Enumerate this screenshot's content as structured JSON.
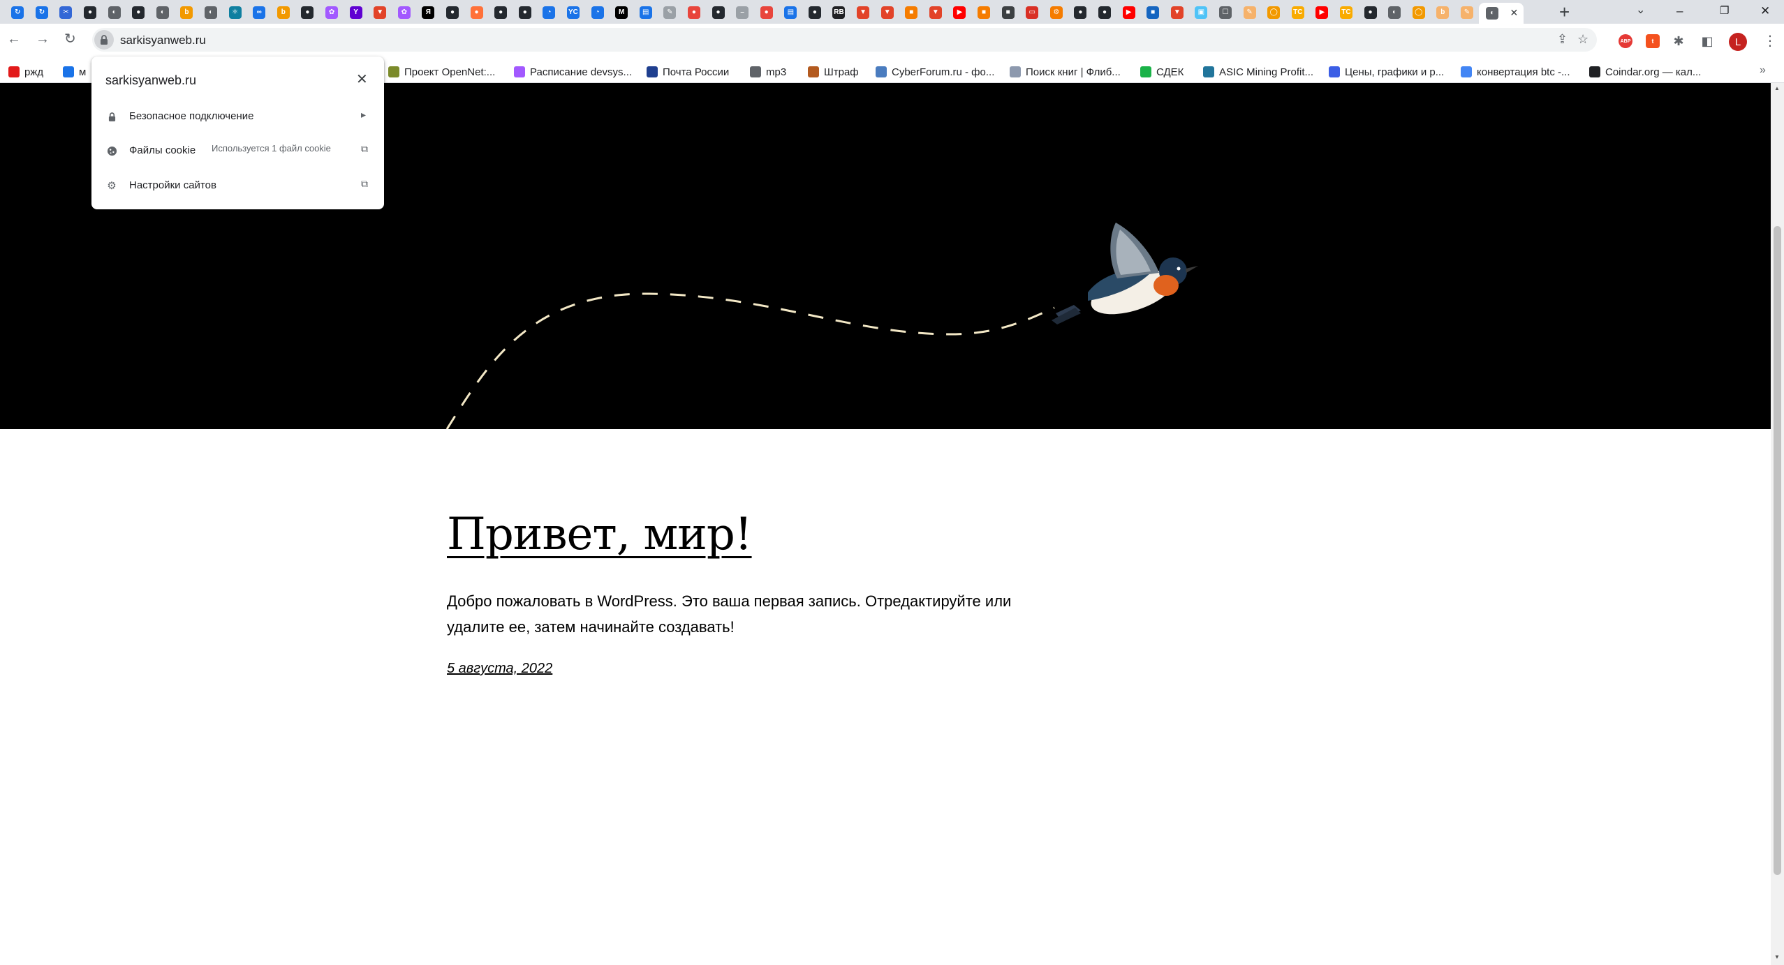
{
  "browser": {
    "tabs": [
      {
        "icon": "sync-icon",
        "color": "#1a73e8",
        "glyph": "↻"
      },
      {
        "icon": "sync-icon",
        "color": "#1a73e8",
        "glyph": "↻"
      },
      {
        "icon": "scissors-icon",
        "color": "#3367d6",
        "glyph": "✂"
      },
      {
        "icon": "github-icon",
        "color": "#24292f",
        "glyph": "●"
      },
      {
        "icon": "globe-icon",
        "color": "#5f6368",
        "glyph": "◐"
      },
      {
        "icon": "github-icon",
        "color": "#24292f",
        "glyph": "●"
      },
      {
        "icon": "globe-icon",
        "color": "#5f6368",
        "glyph": "◐"
      },
      {
        "icon": "site-icon",
        "color": "#f29900",
        "glyph": "b"
      },
      {
        "icon": "globe-icon",
        "color": "#5f6368",
        "glyph": "◐"
      },
      {
        "icon": "react-icon",
        "color": "#0e7fa0",
        "glyph": "⚛"
      },
      {
        "icon": "link-icon",
        "color": "#1a73e8",
        "glyph": "∞"
      },
      {
        "icon": "site-icon",
        "color": "#f29900",
        "glyph": "b"
      },
      {
        "icon": "github-icon",
        "color": "#24292f",
        "glyph": "●"
      },
      {
        "icon": "figma-icon",
        "color": "#a259ff",
        "glyph": "✿"
      },
      {
        "icon": "yahoo-icon",
        "color": "#6001d2",
        "glyph": "Y"
      },
      {
        "icon": "gitlab-icon",
        "color": "#e24329",
        "glyph": "▼"
      },
      {
        "icon": "figma-icon",
        "color": "#a259ff",
        "glyph": "✿"
      },
      {
        "icon": "yandex-icon",
        "color": "#000000",
        "glyph": "Я"
      },
      {
        "icon": "github-icon",
        "color": "#24292f",
        "glyph": "●"
      },
      {
        "icon": "firefox-icon",
        "color": "#ff7139",
        "glyph": "●"
      },
      {
        "icon": "github-icon",
        "color": "#24292f",
        "glyph": "●"
      },
      {
        "icon": "github-icon",
        "color": "#24292f",
        "glyph": "●"
      },
      {
        "icon": "safari-icon",
        "color": "#1a73e8",
        "glyph": "◔"
      },
      {
        "icon": "yc-icon",
        "color": "#1a73e8",
        "glyph": "YC"
      },
      {
        "icon": "safari-icon",
        "color": "#1a73e8",
        "glyph": "◔"
      },
      {
        "icon": "medium-icon",
        "color": "#000000",
        "glyph": "M"
      },
      {
        "icon": "doc-icon",
        "color": "#1a73e8",
        "glyph": "▤"
      },
      {
        "icon": "brush-icon",
        "color": "#9aa0a6",
        "glyph": "✎"
      },
      {
        "icon": "pin-icon",
        "color": "#e8453c",
        "glyph": "●"
      },
      {
        "icon": "github-icon",
        "color": "#24292f",
        "glyph": "●"
      },
      {
        "icon": "dash-icon",
        "color": "#9aa0a6",
        "glyph": "–"
      },
      {
        "icon": "pin-icon",
        "color": "#e8453c",
        "glyph": "●"
      },
      {
        "icon": "doc-icon",
        "color": "#1a73e8",
        "glyph": "▤"
      },
      {
        "icon": "github-icon",
        "color": "#24292f",
        "glyph": "●"
      },
      {
        "icon": "rb-icon",
        "color": "#202124",
        "glyph": "RB"
      },
      {
        "icon": "gitlab-icon",
        "color": "#e24329",
        "glyph": "▼"
      },
      {
        "icon": "gitlab-icon",
        "color": "#e24329",
        "glyph": "▼"
      },
      {
        "icon": "store-icon",
        "color": "#f57c00",
        "glyph": "■"
      },
      {
        "icon": "gitlab-icon",
        "color": "#e24329",
        "glyph": "▼"
      },
      {
        "icon": "youtube-icon",
        "color": "#ff0000",
        "glyph": "▶"
      },
      {
        "icon": "store-icon",
        "color": "#f57c00",
        "glyph": "■"
      },
      {
        "icon": "square-icon",
        "color": "#3c4043",
        "glyph": "■"
      },
      {
        "icon": "screen-icon",
        "color": "#d93025",
        "glyph": "▭"
      },
      {
        "icon": "gear-icon",
        "color": "#f57c00",
        "glyph": "⚙"
      },
      {
        "icon": "github-icon",
        "color": "#24292f",
        "glyph": "●"
      },
      {
        "icon": "github-icon",
        "color": "#24292f",
        "glyph": "●"
      },
      {
        "icon": "youtube-icon",
        "color": "#ff0000",
        "glyph": "▶"
      },
      {
        "icon": "app-icon",
        "color": "#1565c0",
        "glyph": "■"
      },
      {
        "icon": "gitlab-icon",
        "color": "#e24329",
        "glyph": "▼"
      },
      {
        "icon": "image-icon",
        "color": "#4fc3f7",
        "glyph": "▣"
      },
      {
        "icon": "book-icon",
        "color": "#5f6368",
        "glyph": "☐"
      },
      {
        "icon": "brush-icon",
        "color": "#f6b26b",
        "glyph": "✎"
      },
      {
        "icon": "chat-icon",
        "color": "#f29900",
        "glyph": "◯"
      },
      {
        "icon": "tc-icon",
        "color": "#f9ab00",
        "glyph": "TC"
      },
      {
        "icon": "youtube-icon",
        "color": "#ff0000",
        "glyph": "▶"
      },
      {
        "icon": "tc-icon",
        "color": "#f9ab00",
        "glyph": "TC"
      },
      {
        "icon": "github-icon",
        "color": "#24292f",
        "glyph": "●"
      },
      {
        "icon": "globe-icon",
        "color": "#5f6368",
        "glyph": "◐"
      },
      {
        "icon": "chat-icon",
        "color": "#f29900",
        "glyph": "◯"
      },
      {
        "icon": "site-icon",
        "color": "#f6b26b",
        "glyph": "b"
      },
      {
        "icon": "brush-icon",
        "color": "#f6b26b",
        "glyph": "✎"
      }
    ],
    "active_tab": {
      "icon": "globe-icon",
      "color": "#5f6368",
      "glyph": "◐",
      "close_glyph": "✕"
    },
    "new_tab_glyph": "+",
    "tab_search_glyph": "⌄",
    "window_controls": {
      "minimize": "–",
      "restore": "❐",
      "close": "✕"
    },
    "nav": {
      "back": "←",
      "forward": "→",
      "reload": "↻"
    },
    "url": "sarkisyanweb.ru",
    "omnibox_icons": {
      "share": "⇪",
      "star": "☆"
    },
    "extensions": [
      {
        "icon": "adblock-icon",
        "color": "#e53935",
        "glyph": "ABP"
      },
      {
        "icon": "extension-orange-icon",
        "color": "#f4511e",
        "glyph": "t"
      }
    ],
    "puzzle_glyph": "✱",
    "sidepanel_glyph": "◧",
    "profile_initial": "L",
    "profile_color": "#c5221f",
    "menu_glyph": "⋮"
  },
  "bookmarks": {
    "items": [
      {
        "label": "ржд",
        "icon": "rzd-icon",
        "color": "#e21a1a"
      },
      {
        "label": "м",
        "icon": "mail-icon",
        "color": "#1a73e8"
      },
      {
        "label": "Проект OpenNet:...",
        "icon": "star-icon",
        "color": "#7b8a2a"
      },
      {
        "label": "Расписание devsys...",
        "icon": "figma-icon",
        "color": "#a259ff"
      },
      {
        "label": "Почта России",
        "icon": "eagle-icon",
        "color": "#1f3f8f"
      },
      {
        "label": "mp3",
        "icon": "globe-icon",
        "color": "#5f6368"
      },
      {
        "label": "Штраф",
        "icon": "fine-icon",
        "color": "#b35a1f"
      },
      {
        "label": "CyberForum.ru - фо...",
        "icon": "forum-icon",
        "color": "#4a7cbf"
      },
      {
        "label": "Поиск книг | Флиб...",
        "icon": "book-icon",
        "color": "#8d99ae"
      },
      {
        "label": "СДЕК",
        "icon": "cdek-icon",
        "color": "#1ab248"
      },
      {
        "label": "ASIC Mining Profit...",
        "icon": "wordpress-icon",
        "color": "#21759b"
      },
      {
        "label": "Цены, графики и р...",
        "icon": "coin-icon",
        "color": "#3b5ee5"
      },
      {
        "label": "конвертация btc -...",
        "icon": "google-icon",
        "color": "#4285f4"
      },
      {
        "label": "Coindar.org — кал...",
        "icon": "coindar-icon",
        "color": "#202124"
      }
    ],
    "more_glyph": "»"
  },
  "site_popup": {
    "host": "sarkisyanweb.ru",
    "close_glyph": "✕",
    "rows": [
      {
        "label": "Безопасное подключение",
        "sub": "",
        "action_glyph": "▸"
      },
      {
        "label": "Файлы cookie",
        "sub": "Используется 1 файл cookie",
        "action_glyph": "⧉"
      },
      {
        "label": "Настройки сайтов",
        "sub": "",
        "action_glyph": "⧉"
      }
    ]
  },
  "post": {
    "title": "Привет, мир!",
    "body": "Добро пожаловать в WordPress. Это ваша первая запись. Отредактируйте или удалите ее, затем начинайте создавать!",
    "date": "5 августа, 2022"
  },
  "hero": {
    "background": "#000000",
    "path_color": "#f3e8c6"
  },
  "scrollbar": {
    "up": "▲",
    "down": "▼"
  }
}
